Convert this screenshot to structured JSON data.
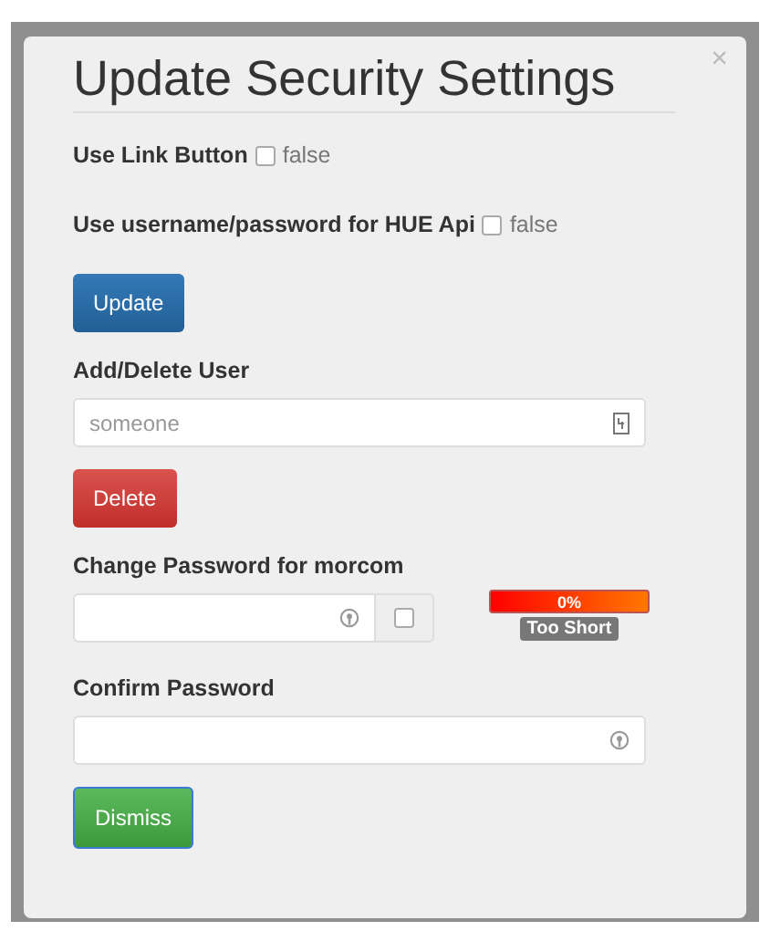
{
  "dialog": {
    "title": "Update Security Settings",
    "close": "×"
  },
  "options": [
    {
      "label": "Use Link Button",
      "checked": false,
      "value": "false"
    },
    {
      "label": "Use username/password for HUE Api",
      "checked": false,
      "value": "false"
    }
  ],
  "update_button": "Update",
  "user": {
    "label": "Add/Delete User",
    "placeholder": "someone"
  },
  "delete_button": "Delete",
  "password": {
    "label": "Change Password for morcom",
    "show_checked": false,
    "strength": "0%",
    "verdict": "Too Short"
  },
  "confirm": {
    "label": "Confirm Password"
  },
  "dismiss_button": "Dismiss"
}
